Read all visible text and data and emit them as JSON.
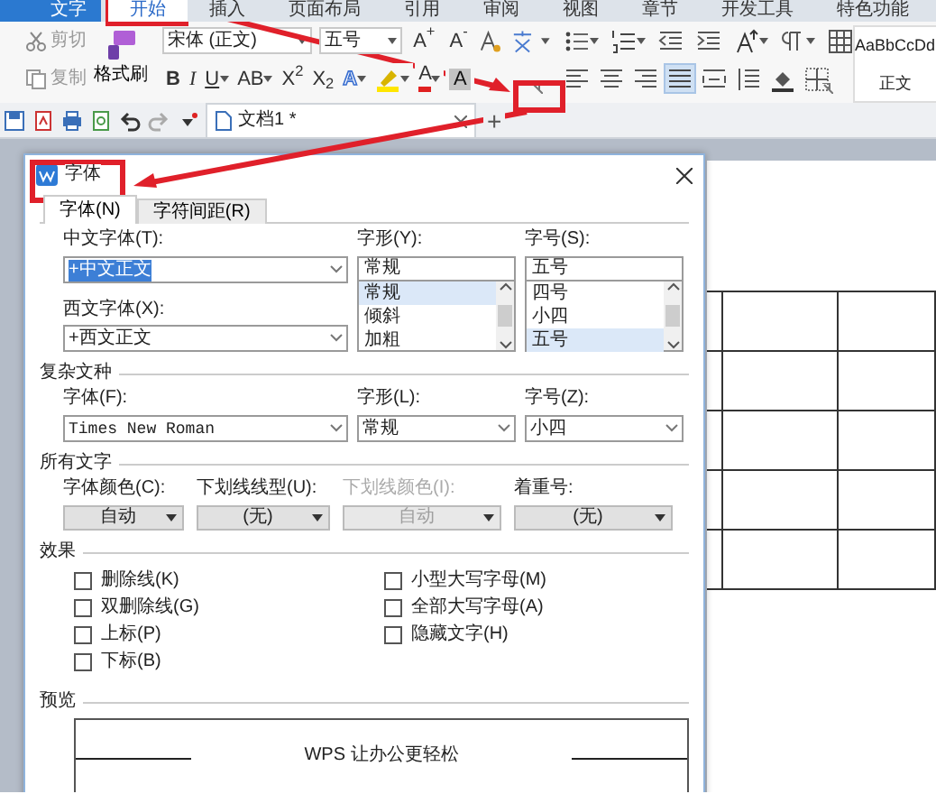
{
  "app_button": "文字",
  "app_tabs": [
    {
      "label": "开始",
      "selected": true
    },
    {
      "label": "插入",
      "selected": false
    },
    {
      "label": "页面布局",
      "selected": false
    },
    {
      "label": "引用",
      "selected": false
    },
    {
      "label": "审阅",
      "selected": false
    },
    {
      "label": "视图",
      "selected": false
    },
    {
      "label": "章节",
      "selected": false
    },
    {
      "label": "开发工具",
      "selected": false
    },
    {
      "label": "特色功能",
      "selected": false
    }
  ],
  "ribbon": {
    "cut": {
      "label": "剪切",
      "disabled": true
    },
    "copy": {
      "label": "复制",
      "disabled": true
    },
    "format_painter": {
      "label": "格式刷"
    },
    "font_name": "宋体 (正文)",
    "font_size": "五号",
    "grow_font": "A$^{+}$",
    "shrink_font": "A$^{-}$",
    "format_buttons": [
      {
        "kind": "bold",
        "label": "B",
        "caret": false
      },
      {
        "kind": "italic",
        "label": "I",
        "caret": false
      },
      {
        "kind": "underline",
        "label": "U",
        "caret": true
      },
      {
        "kind": "strike",
        "label": "AB",
        "caret": true
      },
      {
        "kind": "plain",
        "label": "X$^{2}$",
        "caret": false
      },
      {
        "kind": "plain",
        "label": "X$_{2}$",
        "caret": false
      },
      {
        "kind": "effect",
        "label": "A",
        "caret": true
      },
      {
        "kind": "highlight",
        "caret": true
      },
      {
        "kind": "color",
        "label": "A",
        "caret": true
      },
      {
        "kind": "shade",
        "label": "A",
        "caret": false
      }
    ],
    "paragraph_top": [
      {
        "kind": "bullets",
        "caret": true
      },
      {
        "kind": "numbering",
        "caret": true
      },
      {
        "kind": "outdent",
        "caret": false
      },
      {
        "kind": "indent",
        "caret": false
      },
      {
        "kind": "scale",
        "caret": true
      },
      {
        "kind": "marks",
        "caret": true
      },
      {
        "kind": "grid",
        "caret": false
      }
    ],
    "paragraph_bottom": [
      {
        "kind": "left",
        "selected": false
      },
      {
        "kind": "center",
        "selected": false
      },
      {
        "kind": "right",
        "selected": false
      },
      {
        "kind": "justify",
        "selected": true
      },
      {
        "kind": "distribute",
        "selected": false
      },
      {
        "kind": "spacing",
        "selected": false
      },
      {
        "kind": "fill",
        "selected": false
      },
      {
        "kind": "border",
        "selected": false
      }
    ],
    "style_preview": "AaBbCcDd",
    "style_name": "正文"
  },
  "document_tab": {
    "title": "文档1 *"
  },
  "new_tab": "+",
  "dialog": {
    "title": "字体",
    "tabs": [
      {
        "label": "字体(N)",
        "selected": true
      },
      {
        "label": "字符间距(R)",
        "selected": false
      }
    ],
    "chinese_font": {
      "label": "中文字体(T):",
      "value": "+中文正文",
      "value_selected": true
    },
    "style": {
      "label": "字形(Y):",
      "value": "常规",
      "options": [
        {
          "label": "常规",
          "selected": true
        },
        {
          "label": "倾斜",
          "selected": false
        },
        {
          "label": "加粗",
          "selected": false
        }
      ]
    },
    "size": {
      "label": "字号(S):",
      "value": "五号",
      "options": [
        {
          "label": "四号",
          "selected": false
        },
        {
          "label": "小四",
          "selected": false
        },
        {
          "label": "五号",
          "selected": true
        }
      ]
    },
    "western_font": {
      "label": "西文字体(X):",
      "value": "+西文正文"
    },
    "complex_script": {
      "heading": "复杂文种",
      "fields": [
        {
          "label": "字体(F):",
          "value": "Times New Roman"
        },
        {
          "label": "字形(L):",
          "value": "常规"
        },
        {
          "label": "字号(Z):",
          "value": "小四"
        }
      ]
    },
    "all_text": {
      "heading": "所有文字",
      "fields": [
        {
          "label": "字体颜色(C):",
          "value": "自动",
          "disabled": false
        },
        {
          "label": "下划线线型(U):",
          "value": "(无)",
          "disabled": false
        },
        {
          "label": "下划线颜色(I):",
          "value": "自动",
          "disabled": true
        },
        {
          "label": "着重号:",
          "value": "(无)",
          "disabled": false
        }
      ]
    },
    "effects": {
      "heading": "效果",
      "options": [
        {
          "label": "删除线(K)",
          "checked": false
        },
        {
          "label": "双删除线(G)",
          "checked": false
        },
        {
          "label": "上标(P)",
          "checked": false
        },
        {
          "label": "下标(B)",
          "checked": false
        },
        {
          "label": "小型大写字母(M)",
          "checked": false
        },
        {
          "label": "全部大写字母(A)",
          "checked": false
        },
        {
          "label": "隐藏文字(H)",
          "checked": false
        }
      ]
    },
    "preview": {
      "heading": "预览",
      "text": "WPS 让办公更轻松"
    }
  }
}
